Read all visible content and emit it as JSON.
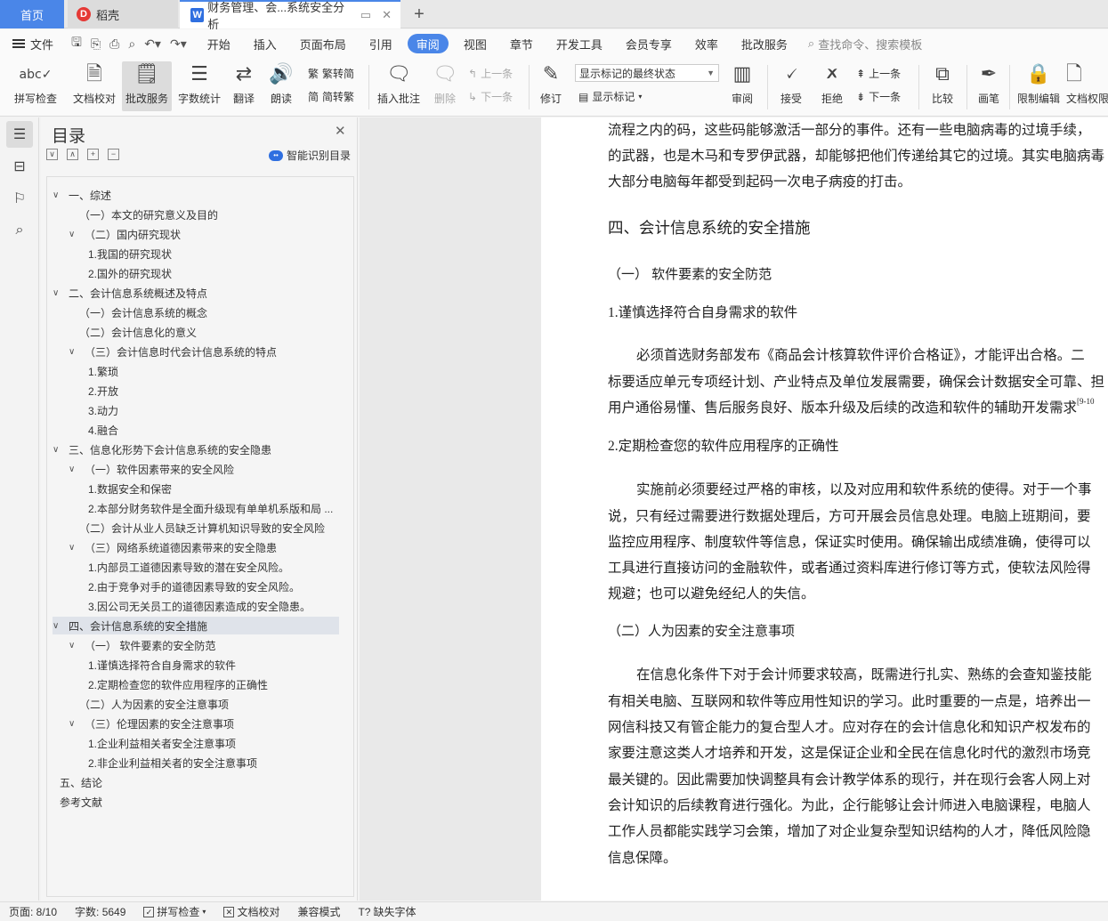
{
  "tabs": {
    "home": "首页",
    "daoke": "稻壳",
    "doc": "财务管理、会...系统安全分析",
    "add": "+"
  },
  "menu": {
    "file": "文件",
    "items": [
      "开始",
      "插入",
      "页面布局",
      "引用",
      "审阅",
      "视图",
      "章节",
      "开发工具",
      "会员专享",
      "效率",
      "批改服务"
    ],
    "search": "查找命令、搜索模板"
  },
  "ribbon": {
    "spell": "拼写检查",
    "proofread": "文档校对",
    "correction": "批改服务",
    "wordcount": "字数统计",
    "translate": "翻译",
    "read": "朗读",
    "trad": "繁转简",
    "simp": "简转繁",
    "insert_comment": "插入批注",
    "delete": "删除",
    "prev": "上一条",
    "next": "下一条",
    "revise": "修订",
    "markup_select": "显示标记的最终状态",
    "show_markup": "显示标记",
    "review": "审阅",
    "accept": "接受",
    "reject": "拒绝",
    "prev2": "上一条",
    "next2": "下一条",
    "compare": "比较",
    "pen": "画笔",
    "restrict": "限制编辑",
    "doc_perm": "文档权限"
  },
  "toc": {
    "title": "目录",
    "smart": "智能识别目录",
    "items": [
      {
        "text": "一、综述",
        "chev": "∨"
      },
      {
        "text": "（一）本文的研究意义及目的",
        "chev": ""
      },
      {
        "text": "（二）国内研究现状",
        "chev": "∨"
      },
      {
        "text": "1.我国的研究现状",
        "chev": ""
      },
      {
        "text": "2.国外的研究现状",
        "chev": ""
      },
      {
        "text": "二、会计信息系统概述及特点",
        "chev": "∨"
      },
      {
        "text": "（一）会计信息系统的概念",
        "chev": ""
      },
      {
        "text": "（二）会计信息化的意义",
        "chev": ""
      },
      {
        "text": "（三）会计信息时代会计信息系统的特点",
        "chev": "∨"
      },
      {
        "text": "1.繁琐",
        "chev": ""
      },
      {
        "text": "2.开放",
        "chev": ""
      },
      {
        "text": "3.动力",
        "chev": ""
      },
      {
        "text": "4.融合",
        "chev": ""
      },
      {
        "text": "三、信息化形势下会计信息系统的安全隐患",
        "chev": "∨"
      },
      {
        "text": "（一）软件因素带来的安全风险",
        "chev": "∨"
      },
      {
        "text": "1.数据安全和保密",
        "chev": ""
      },
      {
        "text": "2.本部分财务软件是全面升级现有单单机系版和局 ...",
        "chev": ""
      },
      {
        "text": "（二）会计从业人员缺乏计算机知识导致的安全风险",
        "chev": ""
      },
      {
        "text": "（三）网络系统道德因素带来的安全隐患",
        "chev": "∨"
      },
      {
        "text": "1.内部员工道德因素导致的潜在安全风险。",
        "chev": ""
      },
      {
        "text": "2.由于竞争对手的道德因素导致的安全风险。",
        "chev": ""
      },
      {
        "text": "3.因公司无关员工的道德因素造成的安全隐患。",
        "chev": ""
      },
      {
        "text": "四、会计信息系统的安全措施",
        "chev": "∨"
      },
      {
        "text": "（一）  软件要素的安全防范",
        "chev": "∨"
      },
      {
        "text": "1.谨慎选择符合自身需求的软件",
        "chev": ""
      },
      {
        "text": "2.定期检查您的软件应用程序的正确性",
        "chev": ""
      },
      {
        "text": "（二）人为因素的安全注意事项",
        "chev": ""
      },
      {
        "text": "（三）伦理因素的安全注意事项",
        "chev": "∨"
      },
      {
        "text": "1.企业利益相关者安全注意事项",
        "chev": ""
      },
      {
        "text": "2.非企业利益相关者的安全注意事项",
        "chev": ""
      },
      {
        "text": "五、结论",
        "chev": ""
      },
      {
        "text": "参考文献",
        "chev": ""
      }
    ]
  },
  "doc": {
    "lines": [
      "流程之内的码，这些码能够激活一部分的事件。还有一些电脑病毒的过境手续，",
      "的武器，也是木马和专罗伊武器，却能够把他们传递给其它的过境。其实电脑病毒",
      "大部分电脑每年都受到起码一次电子病疫的打击。",
      "四、会计信息系统的安全措施",
      "（一）  软件要素的安全防范",
      "1.谨慎选择符合自身需求的软件",
      "必须首选财务部发布《商品会计核算软件评价合格证》，才能评出合格。二",
      "标要适应单元专项经计划、产业特点及单位发展需要，确保会计数据安全可靠、担",
      "用户通俗易懂、售后服务良好、版本升级及后续的改造和软件的辅助开发需求",
      "2.定期检查您的软件应用程序的正确性",
      "实施前必须要经过严格的审核，以及对应用和软件系统的使得。对于一个事",
      "说，只有经过需要进行数据处理后，方可开展会员信息处理。电脑上班期间，要",
      "监控应用程序、制度软件等信息，保证实时使用。确保输出成绩准确，使得可以",
      "工具进行直接访问的金融软件，或者通过资料库进行修订等方式，使软法风险得",
      "规避；也可以避免经纪人的失信。",
      "（二）人为因素的安全注意事项",
      "在信息化条件下对于会计师要求较高，既需进行扎实、熟练的会查知鉴技能",
      "有相关电脑、互联网和软件等应用性知识的学习。此时重要的一点是，培养出一",
      "网信科技又有管企能力的复合型人才。应对存在的会计信息化和知识产权发布的",
      "家要注意这类人才培养和开发，这是保证企业和全民在信息化时代的激烈市场竞",
      "最关键的。因此需要加快调整具有会计教学体系的现行，并在现行会客人网上对",
      "会计知识的后续教育进行强化。为此，企行能够让会计师进入电脑课程，电脑人",
      "工作人员都能实践学习会策，增加了对企业复杂型知识结构的人才，降低风险隐",
      "信息保障。"
    ],
    "ref_mark": "[9-10"
  },
  "status": {
    "page": "页面: 8/10",
    "words": "字数: 5649",
    "spell": "拼写检查",
    "proof": "文档校对",
    "compat": "兼容模式",
    "missing_font": "缺失字体"
  }
}
